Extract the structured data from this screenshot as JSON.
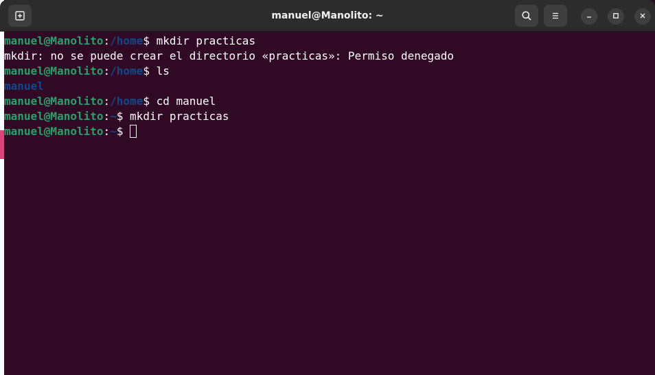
{
  "window": {
    "title": "manuel@Manolito: ~"
  },
  "icons": {
    "new_tab": "new-tab-icon",
    "search": "search-icon",
    "menu": "hamburger-menu-icon",
    "minimize": "minimize-icon",
    "maximize": "maximize-icon",
    "close": "close-icon"
  },
  "colors": {
    "background": "#300a24",
    "user_host": "#26a269",
    "path": "#12488b",
    "text": "#ffffff"
  },
  "terminal": {
    "lines": [
      {
        "user": "manuel@Manolito",
        "sep": ":",
        "path": "/home",
        "prompt": "$ ",
        "command": "mkdir practicas"
      },
      {
        "output": "mkdir: no se puede crear el directorio «practicas»: Permiso denegado"
      },
      {
        "user": "manuel@Manolito",
        "sep": ":",
        "path": "/home",
        "prompt": "$ ",
        "command": "ls"
      },
      {
        "dir": "manuel"
      },
      {
        "user": "manuel@Manolito",
        "sep": ":",
        "path": "/home",
        "prompt": "$ ",
        "command": "cd manuel"
      },
      {
        "user": "manuel@Manolito",
        "sep": ":",
        "path": "~",
        "prompt": "$ ",
        "command": "mkdir practicas"
      },
      {
        "user": "manuel@Manolito",
        "sep": ":",
        "path": "~",
        "prompt": "$ ",
        "command": ""
      }
    ]
  }
}
